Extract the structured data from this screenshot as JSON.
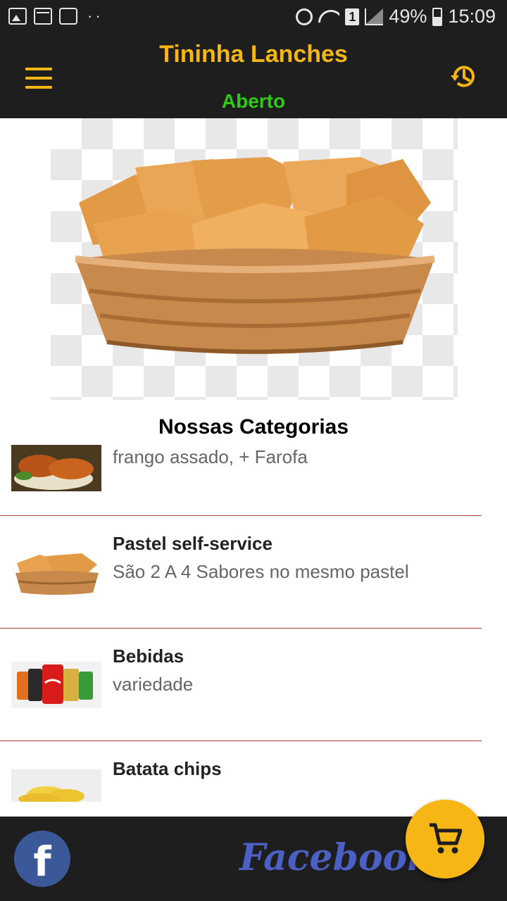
{
  "status_bar": {
    "icons_left": [
      "image-icon",
      "calendar-icon",
      "voicemail-icon"
    ],
    "dots": "··",
    "sim_slot": "1",
    "battery": "49%",
    "time": "15:09"
  },
  "app_bar": {
    "title": "Tininha Lanches",
    "status": "Aberto",
    "menu_icon": "hamburger-menu-icon",
    "history_icon": "history-icon"
  },
  "banner": {
    "image": "basket-of-pastel-image"
  },
  "section": {
    "title": "Nossas Categorias"
  },
  "categories": [
    {
      "name": "",
      "description": "frango assado, + Farofa",
      "thumb": "roast-chicken-image"
    },
    {
      "name": "Pastel self-service",
      "description": "São 2 A 4 Sabores  no mesmo pastel",
      "thumb": "pastel-basket-image"
    },
    {
      "name": "Bebidas",
      "description": "variedade",
      "thumb": "soda-cans-image"
    },
    {
      "name": "Batata chips",
      "description": "",
      "thumb": "potato-chips-image"
    }
  ],
  "bottom_bar": {
    "facebook_icon_letter": "f",
    "facebook_label": "Facebook",
    "cart_icon": "shopping-cart-icon"
  },
  "colors": {
    "bar_background": "#1e1e1e",
    "accent_yellow": "#f6b716",
    "open_green": "#2ecb14",
    "divider_red": "#b23a3a",
    "facebook_blue": "#3b5998"
  }
}
